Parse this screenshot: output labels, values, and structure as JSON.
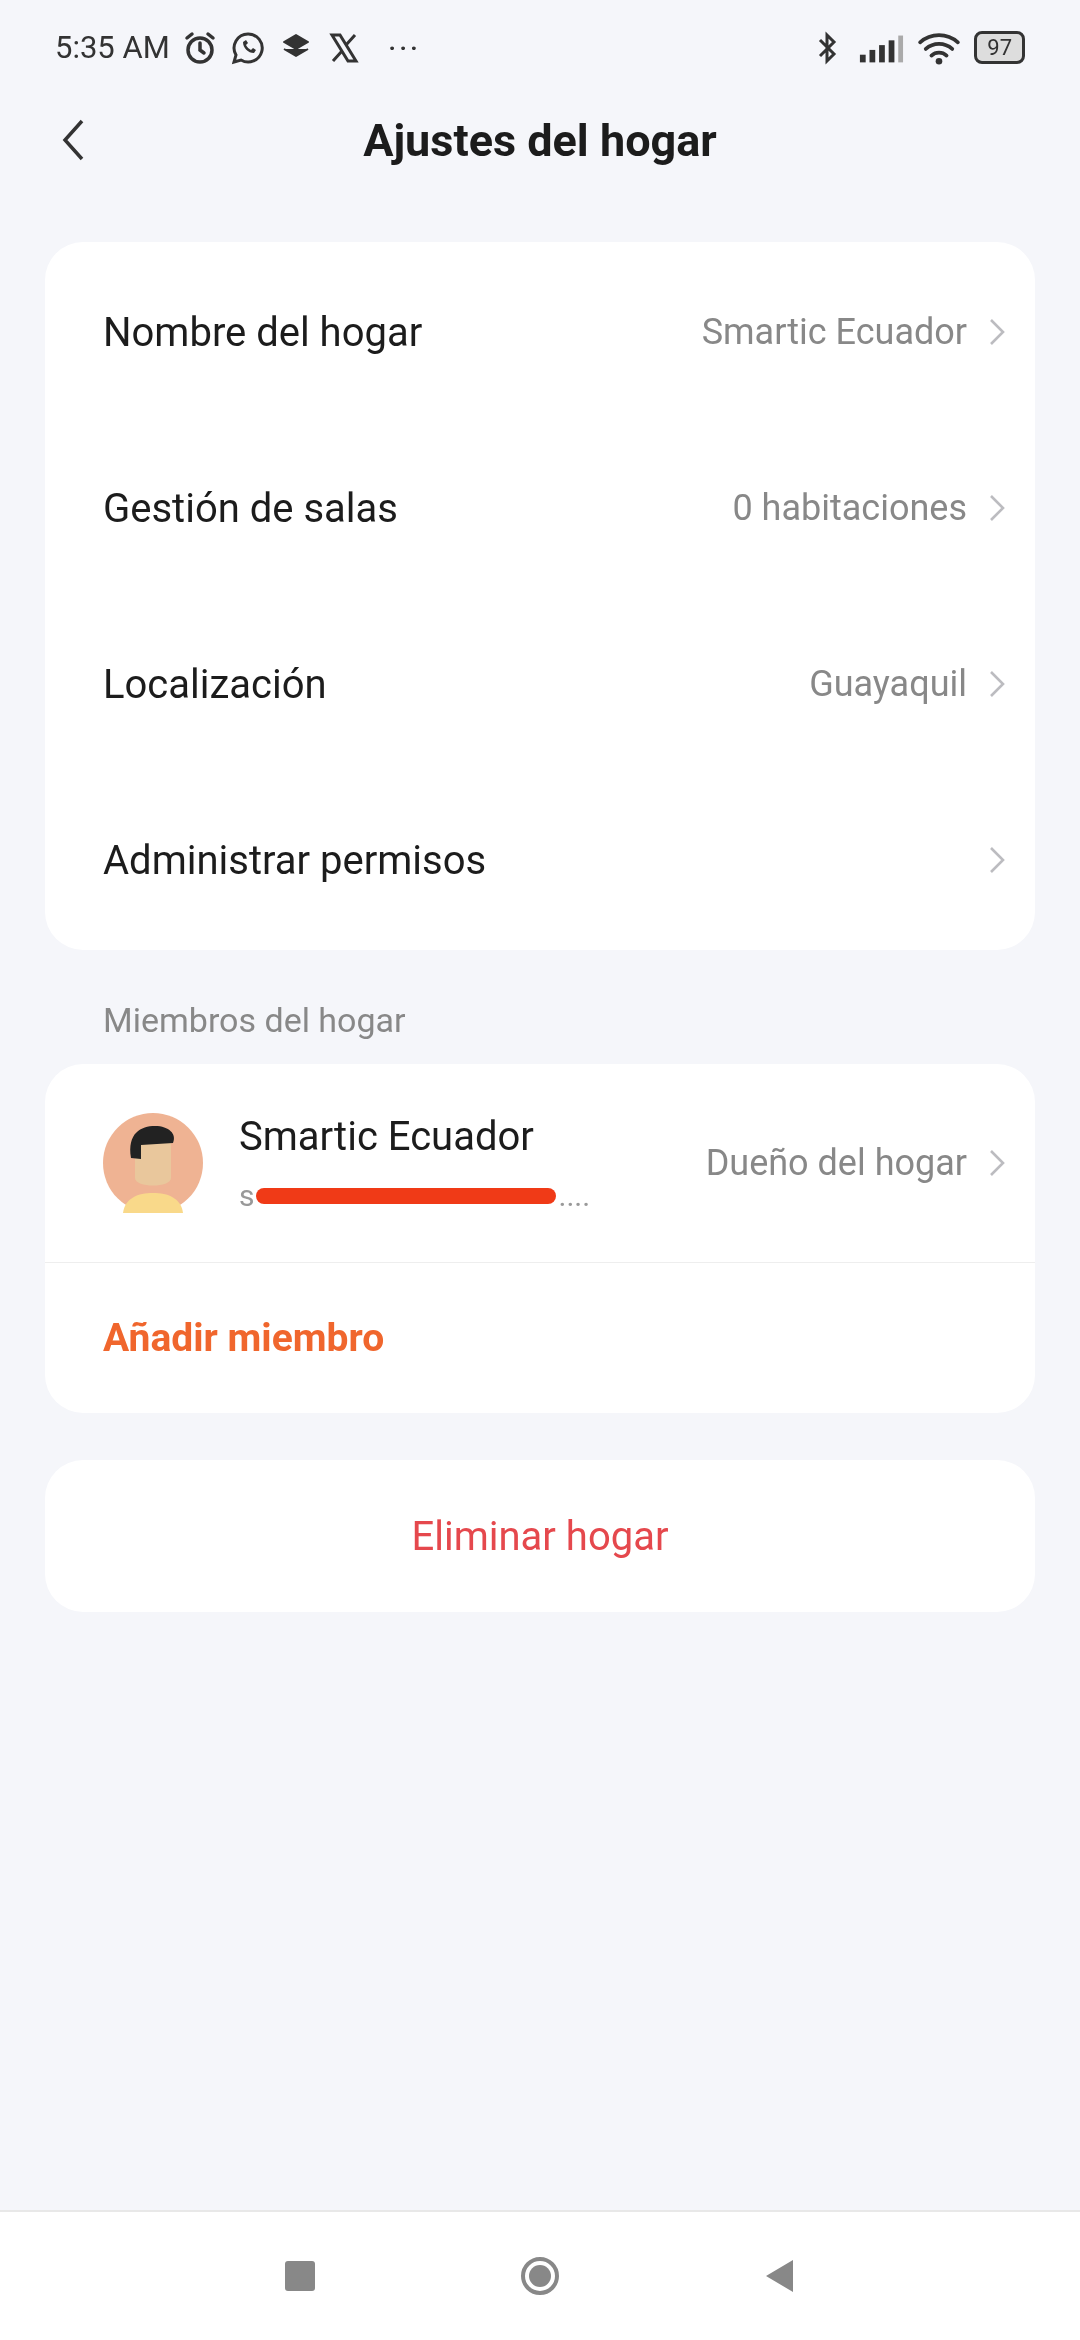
{
  "status_bar": {
    "time": "5:35 AM",
    "more": "···",
    "battery": "97"
  },
  "header": {
    "title": "Ajustes del hogar"
  },
  "settings": [
    {
      "label": "Nombre del hogar",
      "value": "Smartic Ecuador"
    },
    {
      "label": "Gestión de salas",
      "value": "0 habitaciones"
    },
    {
      "label": "Localización",
      "value": "Guayaquil"
    },
    {
      "label": "Administrar permisos"
    }
  ],
  "members_section": {
    "title": "Miembros del hogar",
    "members": [
      {
        "name": "Smartic Ecuador",
        "email_start": "s",
        "email_end": "....",
        "role": "Dueño del hogar"
      }
    ],
    "add_button": "Añadir miembro"
  },
  "delete_button": "Eliminar hogar"
}
